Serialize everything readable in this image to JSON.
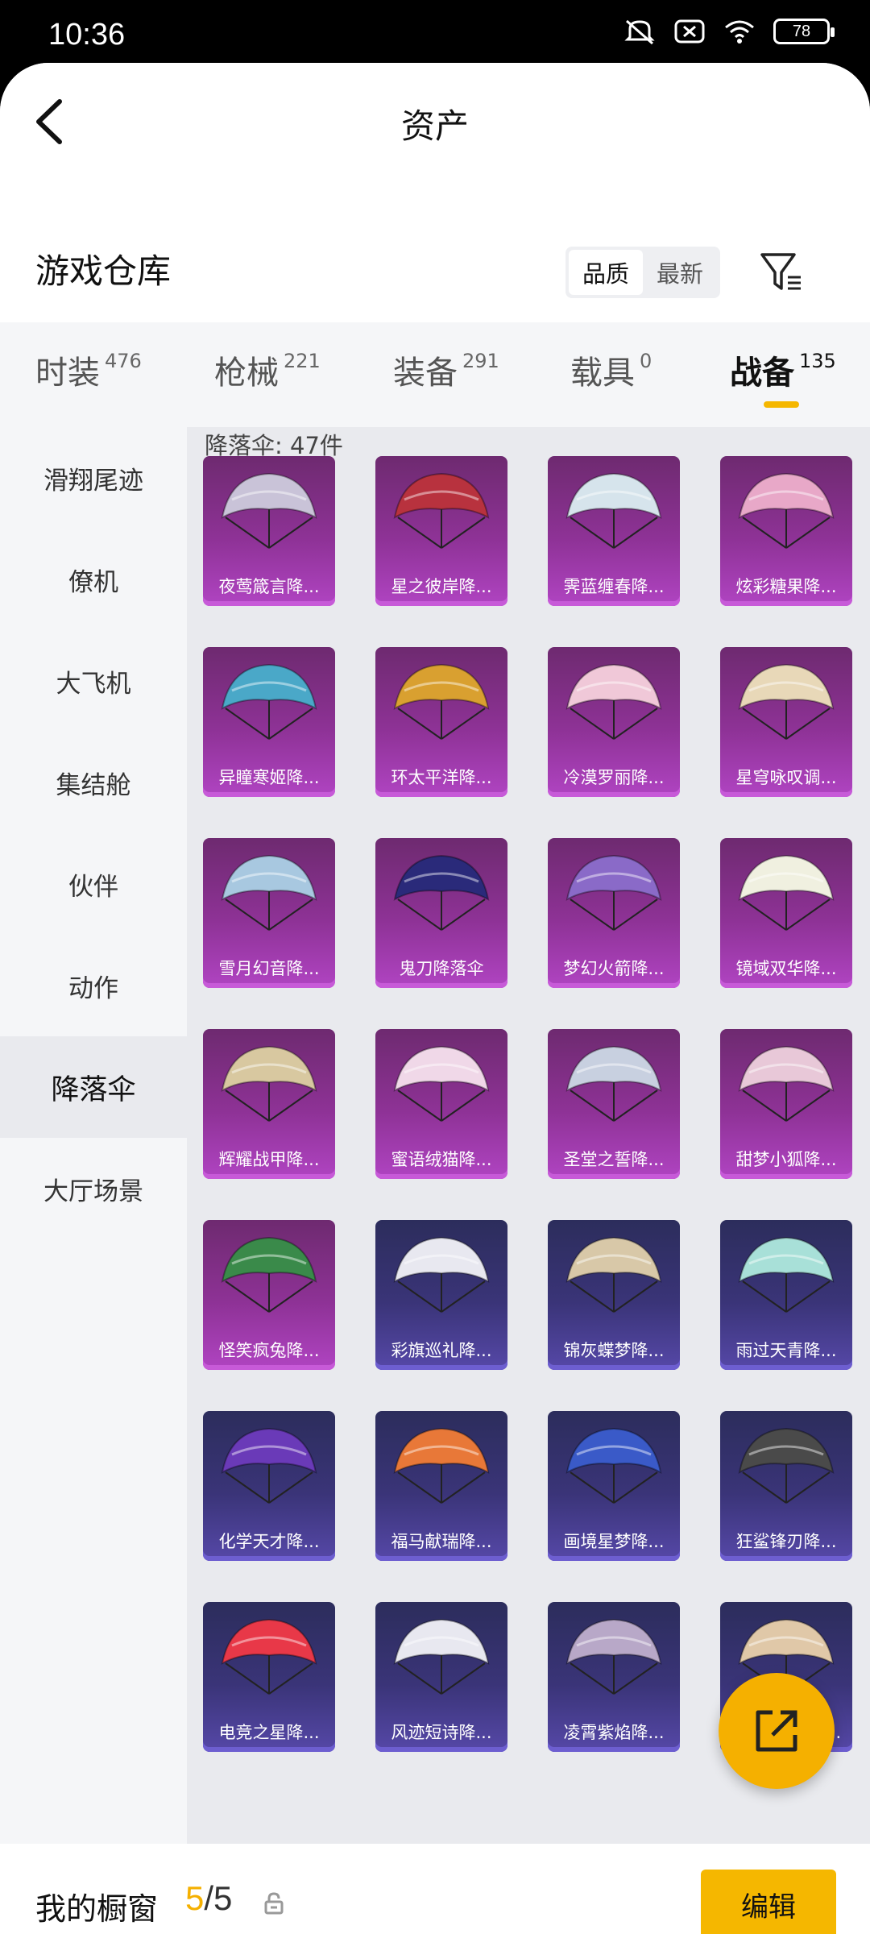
{
  "status_bar": {
    "time": "10:36",
    "battery": "78",
    "icons": [
      "mute-icon",
      "sim-off-icon",
      "wifi-icon",
      "battery-icon"
    ]
  },
  "header": {
    "title": "资产",
    "back_icon": "chevron-left-icon"
  },
  "section": {
    "title": "游戏仓库",
    "sort_options": [
      "品质",
      "最新"
    ],
    "active_sort": "品质",
    "filter_icon": "filter-icon"
  },
  "tabs": [
    {
      "label": "时装",
      "count": "476"
    },
    {
      "label": "枪械",
      "count": "221"
    },
    {
      "label": "装备",
      "count": "291"
    },
    {
      "label": "载具",
      "count": "0"
    },
    {
      "label": "战备",
      "count": "135",
      "active": true
    }
  ],
  "sidebar": {
    "items": [
      {
        "label": "滑翔尾迹"
      },
      {
        "label": "僚机"
      },
      {
        "label": "大飞机"
      },
      {
        "label": "集结舱"
      },
      {
        "label": "伙伴"
      },
      {
        "label": "动作"
      },
      {
        "label": "降落伞",
        "active": true
      },
      {
        "label": "大厅场景"
      }
    ]
  },
  "main": {
    "count_label": "降落伞: 47件",
    "items": [
      {
        "name": "夜莺箴言降...",
        "rarity": "purple"
      },
      {
        "name": "星之彼岸降...",
        "rarity": "purple"
      },
      {
        "name": "霁蓝缠春降...",
        "rarity": "purple"
      },
      {
        "name": "炫彩糖果降...",
        "rarity": "purple"
      },
      {
        "name": "异瞳寒姬降...",
        "rarity": "purple"
      },
      {
        "name": "环太平洋降...",
        "rarity": "purple"
      },
      {
        "name": "冷漠罗丽降...",
        "rarity": "purple"
      },
      {
        "name": "星穹咏叹调...",
        "rarity": "purple"
      },
      {
        "name": "雪月幻音降...",
        "rarity": "purple"
      },
      {
        "name": "鬼刀降落伞",
        "rarity": "purple"
      },
      {
        "name": "梦幻火箭降...",
        "rarity": "purple"
      },
      {
        "name": "镜域双华降...",
        "rarity": "purple"
      },
      {
        "name": "辉耀战甲降...",
        "rarity": "purple"
      },
      {
        "name": "蜜语绒猫降...",
        "rarity": "purple"
      },
      {
        "name": "圣堂之誓降...",
        "rarity": "purple"
      },
      {
        "name": "甜梦小狐降...",
        "rarity": "purple"
      },
      {
        "name": "怪笑疯兔降...",
        "rarity": "purple"
      },
      {
        "name": "彩旗巡礼降...",
        "rarity": "navy"
      },
      {
        "name": "锦灰蝶梦降...",
        "rarity": "navy"
      },
      {
        "name": "雨过天青降...",
        "rarity": "navy"
      },
      {
        "name": "化学天才降...",
        "rarity": "navy"
      },
      {
        "name": "福马献瑞降...",
        "rarity": "navy"
      },
      {
        "name": "画境星梦降...",
        "rarity": "navy"
      },
      {
        "name": "狂鲨锋刃降...",
        "rarity": "navy"
      },
      {
        "name": "电竞之星降...",
        "rarity": "navy"
      },
      {
        "name": "风迹短诗降...",
        "rarity": "navy"
      },
      {
        "name": "凌霄紫焰降...",
        "rarity": "navy"
      },
      {
        "name": "SS33王牌降...",
        "rarity": "navy"
      }
    ],
    "canopy_colors": [
      "#c9c3d8",
      "#b8323e",
      "#d6e4ec",
      "#e8a8c8",
      "#4aa8c8",
      "#d9a030",
      "#f0c8d8",
      "#e8d8b8",
      "#a8c8e0",
      "#2a2a7a",
      "#8a6ac8",
      "#f0f0e0",
      "#d8c8a0",
      "#f0d8e8",
      "#c8d0e0",
      "#e8c8d8",
      "#3a8a4a",
      "#e8e8f0",
      "#d8c8a8",
      "#a8e0d8",
      "#6a3ab8",
      "#e87838",
      "#3a5ac8",
      "#4a4a4a",
      "#e83848",
      "#e8e8f0",
      "#b8a8c8",
      "#e0c8a8"
    ]
  },
  "fab": {
    "icon": "share-external-icon"
  },
  "bottom": {
    "label": "我的橱窗",
    "current": "5",
    "separator": "/",
    "total": "5",
    "lock_icon": "lock-icon",
    "edit_label": "编辑"
  }
}
